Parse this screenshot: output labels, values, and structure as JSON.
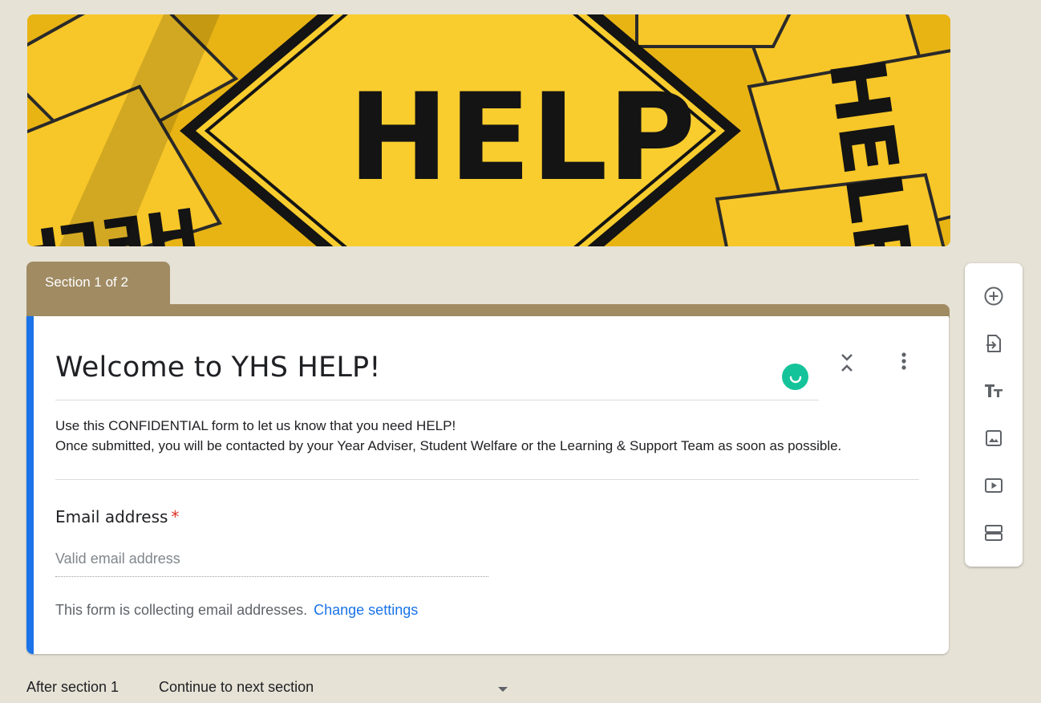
{
  "header_image": {
    "words": [
      "HELP",
      "HELP",
      "HELP"
    ]
  },
  "section": {
    "tab_label": "Section 1 of 2"
  },
  "form": {
    "title": "Welcome to YHS HELP!",
    "description_line1": "Use this CONFIDENTIAL form to let us know that you need HELP!",
    "description_line2": "Once submitted,  you will be contacted by your Year Adviser, Student Welfare or the Learning & Support Team as soon as possible."
  },
  "question": {
    "label": "Email address",
    "required_mark": "*",
    "placeholder": "Valid email address"
  },
  "collecting": {
    "text": "This form is collecting email addresses.",
    "link": "Change settings"
  },
  "after_section": {
    "label": "After section 1",
    "selected": "Continue to next section"
  },
  "toolbar": {
    "items": [
      "add-question",
      "import-questions",
      "add-title",
      "add-image",
      "add-video",
      "add-section"
    ]
  },
  "colors": {
    "accent": "#1a73e8",
    "theme": "#a08b63",
    "background": "#e6e2d6",
    "required": "#d93025"
  }
}
